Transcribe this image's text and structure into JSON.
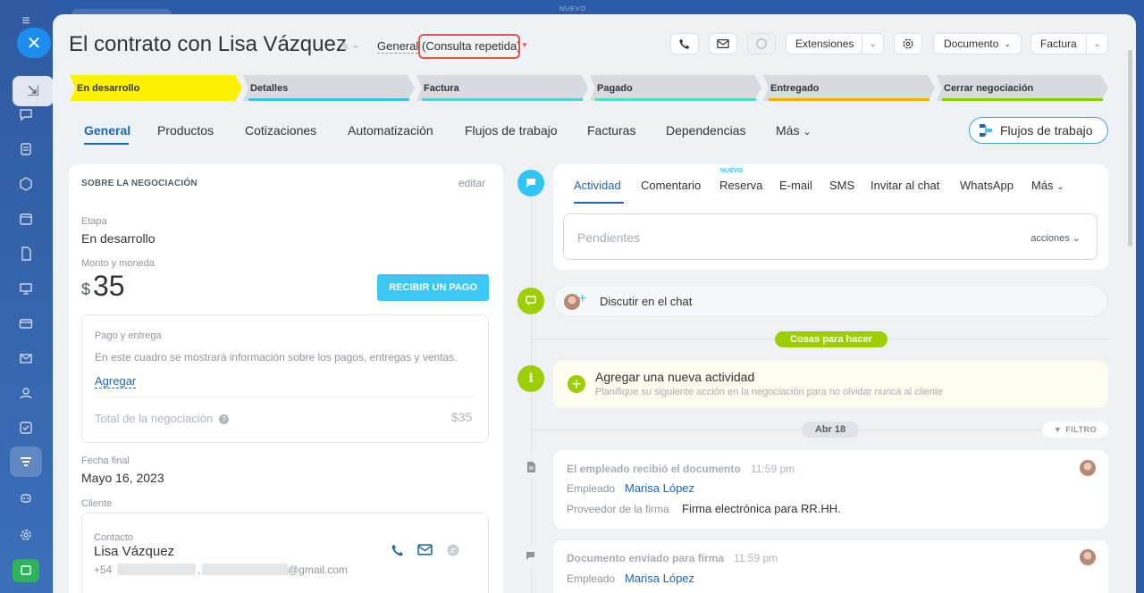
{
  "top": {
    "new_label": "NUEVO"
  },
  "header": {
    "title": "El contrato con Lisa Vázquez",
    "category": "General",
    "tag": "(Consulta repetida)",
    "extensions": "Extensiones",
    "document": "Documento",
    "invoice": "Factura"
  },
  "stages": [
    {
      "label": "En desarrollo",
      "color": "#fff200"
    },
    {
      "label": "Detalles",
      "color": "#2fc6f6"
    },
    {
      "label": "Factura",
      "color": "#55d0e0"
    },
    {
      "label": "Pagado",
      "color": "#47e4c2"
    },
    {
      "label": "Entregado",
      "color": "#ffa900"
    },
    {
      "label": "Cerrar negociación",
      "color": "#7bd500"
    }
  ],
  "tabs": [
    "General",
    "Productos",
    "Cotizaciones",
    "Automatización",
    "Flujos de trabajo",
    "Facturas",
    "Dependencias",
    "Más"
  ],
  "flow_button": "Flujos de trabajo",
  "deal": {
    "section_title": "SOBRE LA NEGOCIACIÓN",
    "edit": "editar",
    "stage_label": "Etapa",
    "stage_value": "En desarrollo",
    "amount_label": "Monto y moneda",
    "currency": "$",
    "amount": "35",
    "pay_button": "RECIBIR UN PAGO",
    "payment_title": "Pago y entrega",
    "payment_text": "En este cuadro se mostrará información sobre los pagos, entregas y ventas.",
    "add": "Agregar",
    "total_label": "Total de la negociación",
    "total_value": "$35",
    "end_label": "Fecha final",
    "end_value": "Mayo 16, 2023",
    "client_label": "Cliente",
    "contact_label": "Contacto",
    "contact_name": "Lisa Vázquez",
    "phone_prefix": "+54",
    "email_suffix": "@gmail.com"
  },
  "activity": {
    "tabs": [
      "Actividad",
      "Comentario",
      "Reserva",
      "E-mail",
      "SMS",
      "Invitar al chat",
      "WhatsApp",
      "Más"
    ],
    "new_badge": "NUEVO",
    "pending": "Pendientes",
    "actions": "acciones",
    "chat": "Discutir en el chat",
    "todo_pill": "Cosas para hacer",
    "todo_title": "Agregar una nueva actividad",
    "todo_sub": "Planifique su siguiente acción en la negociación para no olvidar nunca al cliente",
    "date": "Abr 18",
    "filter": "FILTRO"
  },
  "events": [
    {
      "title": "El empleado recibió el documento",
      "time": "11:59 pm",
      "k1": "Empleado",
      "v1": "Marisa López",
      "k2": "Proveedor de la firma",
      "v2": "Firma electrónica para RR.HH."
    },
    {
      "title": "Documento enviado para firma",
      "time": "11:59 pm",
      "k1": "Empleado",
      "v1": "Marisa López"
    }
  ]
}
